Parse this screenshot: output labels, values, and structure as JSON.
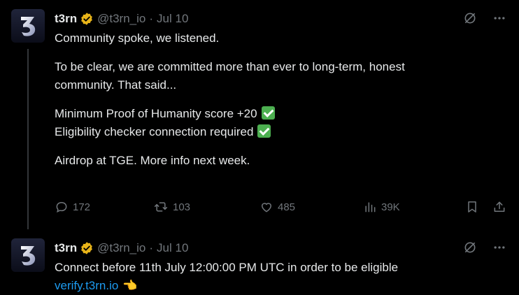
{
  "colors": {
    "background": "#000000",
    "text": "#e7e9ea",
    "muted": "#71767b",
    "link": "#1d9bf0",
    "verified": "#e8b419",
    "checkmark": "#4caf50"
  },
  "tweets": [
    {
      "author_name": "t3rn",
      "handle": "@t3rn_io",
      "separator": "·",
      "date": "Jul 10",
      "avatar_text": "3",
      "lines": [
        "Community spoke, we listened.",
        "To be clear, we are committed more than ever to long-term, honest",
        "community. That said...",
        "Minimum Proof of Humanity score +20",
        "Eligibility checker connection required",
        "Airdrop at TGE. More info next week."
      ],
      "metrics": {
        "replies": "172",
        "reposts": "103",
        "likes": "485",
        "views": "39K"
      },
      "icons": [
        "grok-icon",
        "more-icon",
        "reply-icon",
        "repost-icon",
        "like-icon",
        "views-icon",
        "bookmark-icon",
        "share-icon",
        "check-emoji-icon"
      ]
    },
    {
      "author_name": "t3rn",
      "handle": "@t3rn_io",
      "separator": "·",
      "date": "Jul 10",
      "avatar_text": "3",
      "text": "Connect before 11th July 12:00:00 PM UTC in order to be eligible",
      "link": "verify.t3rn.io",
      "emoji": "👈"
    }
  ]
}
